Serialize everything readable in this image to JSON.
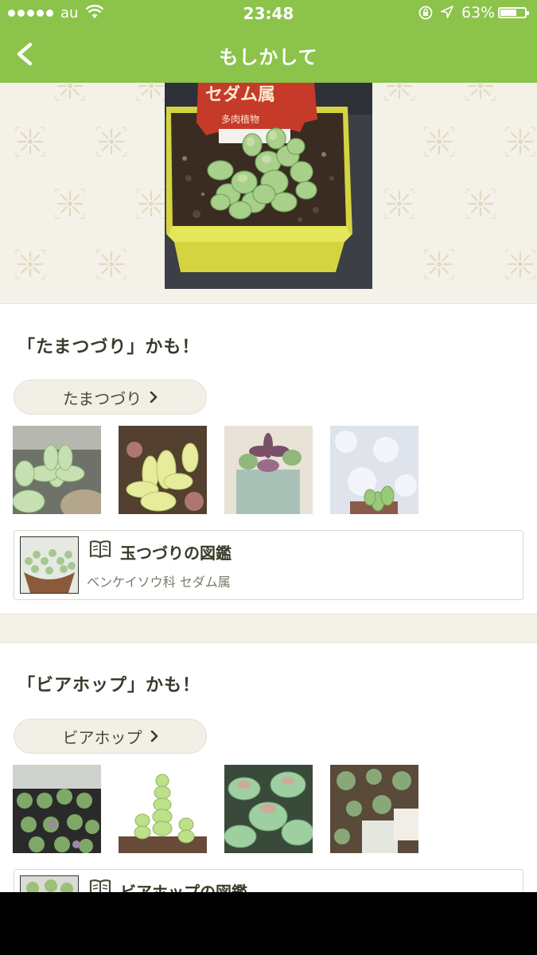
{
  "status_bar": {
    "carrier": "au",
    "time": "23:48",
    "battery_percent": "63%",
    "battery_level": 0.63
  },
  "nav": {
    "title": "もしかして"
  },
  "results": [
    {
      "heading": "「たまつづり」かも！",
      "name_button": "たまつづり",
      "encyclopedia_title": "玉つづりの図鑑",
      "encyclopedia_sub": "ベンケイソウ科 セダム属"
    },
    {
      "heading": "「ビアホップ」かも！",
      "name_button": "ビアホップ",
      "encyclopedia_title": "ビアホップの図鑑"
    }
  ],
  "hero_photo": {
    "tag_text": "セダム属",
    "tag_subtext": "多肉植物"
  },
  "colors": {
    "accent": "#8cc34b",
    "background_pattern": "#f3f1e8"
  }
}
